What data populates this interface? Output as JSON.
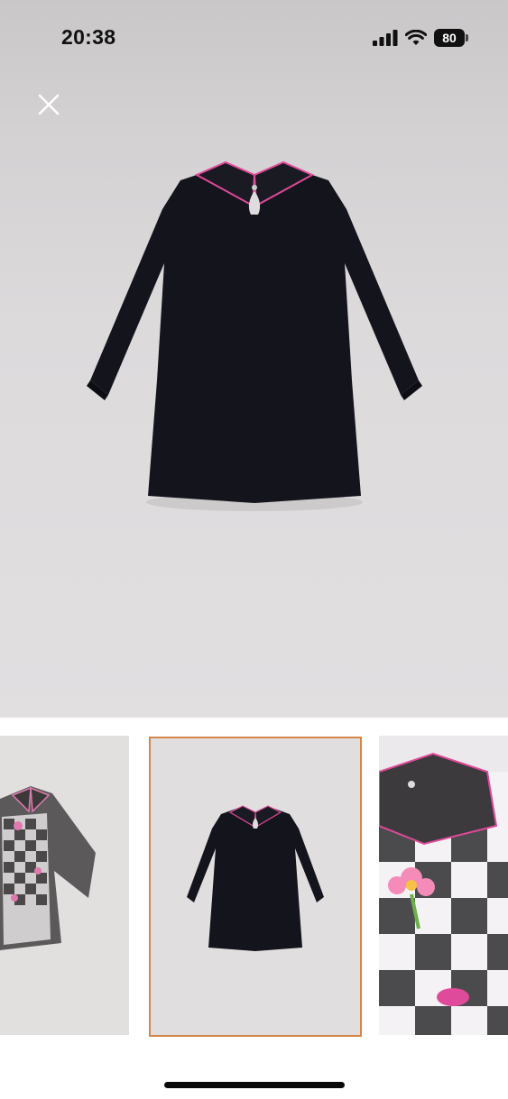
{
  "status_bar": {
    "time": "20:38",
    "battery": "80",
    "icons": [
      "signal-icon",
      "wifi-icon",
      "battery-icon"
    ]
  },
  "viewer": {
    "close_icon": "close-icon",
    "main_image": "black-dress-with-pink-piped-collar",
    "thumbnails": [
      {
        "image": "checkered-print-dress-front"
      },
      {
        "image": "black-dress-with-pink-piped-collar",
        "selected": true
      },
      {
        "image": "checkered-print-collar-detail"
      }
    ]
  },
  "colors": {
    "selected_border": "#d4864a",
    "piping": "#e04a9a",
    "dress": "#14141c"
  }
}
